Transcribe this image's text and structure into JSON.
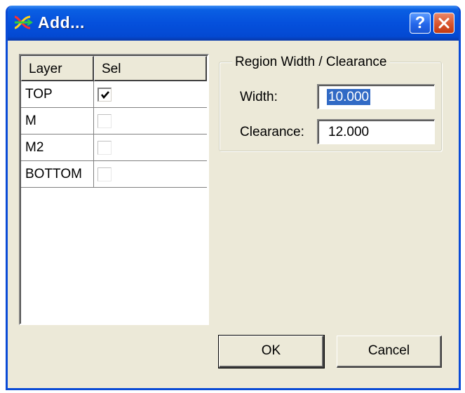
{
  "window": {
    "title": "Add...",
    "help_label": "?",
    "titlebar_color": "#0550dc",
    "face_color": "#ece9d8"
  },
  "icons": {
    "app": "app-logo-icon",
    "help": "help-icon",
    "close": "close-icon",
    "check": "checkmark-icon"
  },
  "layer_list": {
    "columns": [
      "Layer",
      "Sel"
    ],
    "rows": [
      {
        "layer": "TOP",
        "selected": true
      },
      {
        "layer": "M",
        "selected": false
      },
      {
        "layer": "M2",
        "selected": false
      },
      {
        "layer": "BOTTOM",
        "selected": false
      }
    ]
  },
  "region": {
    "group_title": "Region Width / Clearance",
    "width_label": "Width:",
    "width_value": "10.000",
    "clearance_label": "Clearance:",
    "clearance_value": "12.000"
  },
  "buttons": {
    "ok": "OK",
    "cancel": "Cancel"
  }
}
